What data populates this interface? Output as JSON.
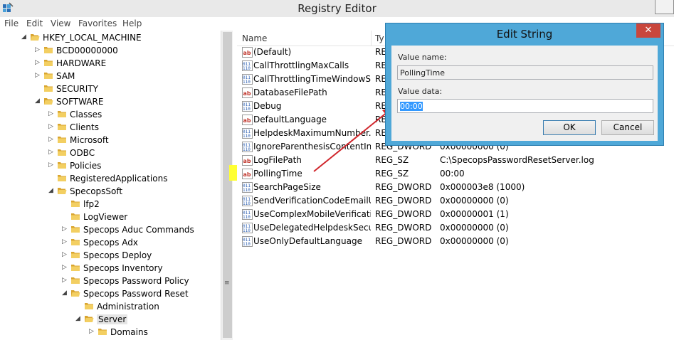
{
  "window": {
    "title": "Registry Editor"
  },
  "menu": [
    "File",
    "Edit",
    "View",
    "Favorites",
    "Help"
  ],
  "tree": [
    {
      "label": "HKEY_LOCAL_MACHINE",
      "state": "expanded"
    },
    {
      "label": "BCD00000000",
      "state": "collapsed"
    },
    {
      "label": "HARDWARE",
      "state": "collapsed"
    },
    {
      "label": "SAM",
      "state": "collapsed"
    },
    {
      "label": "SECURITY",
      "state": "none"
    },
    {
      "label": "SOFTWARE",
      "state": "expanded"
    },
    {
      "label": "Classes",
      "state": "collapsed"
    },
    {
      "label": "Clients",
      "state": "collapsed"
    },
    {
      "label": "Microsoft",
      "state": "collapsed"
    },
    {
      "label": "ODBC",
      "state": "collapsed"
    },
    {
      "label": "Policies",
      "state": "collapsed"
    },
    {
      "label": "RegisteredApplications",
      "state": "none"
    },
    {
      "label": "SpecopsSoft",
      "state": "expanded"
    },
    {
      "label": "lfp2",
      "state": "none"
    },
    {
      "label": "LogViewer",
      "state": "none"
    },
    {
      "label": "Specops Aduc Commands",
      "state": "collapsed"
    },
    {
      "label": "Specops Adx",
      "state": "collapsed"
    },
    {
      "label": "Specops Deploy",
      "state": "collapsed"
    },
    {
      "label": "Specops Inventory",
      "state": "collapsed"
    },
    {
      "label": "Specops Password Policy",
      "state": "collapsed"
    },
    {
      "label": "Specops Password Reset",
      "state": "expanded"
    },
    {
      "label": "Administration",
      "state": "none"
    },
    {
      "label": "Server",
      "state": "expanded"
    },
    {
      "label": "Domains",
      "state": "collapsed"
    }
  ],
  "list": {
    "columns": [
      "Name",
      "Ty"
    ],
    "rows": [
      {
        "name": "(Default)",
        "type": "REG",
        "data": "",
        "icon": "string-value-icon"
      },
      {
        "name": "CallThrottlingMaxCalls",
        "type": "REG",
        "data": "",
        "icon": "dword-value-icon"
      },
      {
        "name": "CallThrottlingTimeWindowS...",
        "type": "REG",
        "data": "",
        "icon": "dword-value-icon"
      },
      {
        "name": "DatabaseFilePath",
        "type": "REG",
        "data": "",
        "icon": "string-value-icon"
      },
      {
        "name": "Debug",
        "type": "REG",
        "data": "",
        "icon": "dword-value-icon"
      },
      {
        "name": "DefaultLanguage",
        "type": "REG",
        "data": "",
        "icon": "string-value-icon"
      },
      {
        "name": "HelpdeskMaximumNumber...",
        "type": "REG",
        "data": "",
        "icon": "dword-value-icon"
      },
      {
        "name": "IgnoreParenthesisContentInP...",
        "type": "REG_DWORD",
        "data": "0x00000000 (0)",
        "icon": "dword-value-icon"
      },
      {
        "name": "LogFilePath",
        "type": "REG_SZ",
        "data": "C:\\SpecopsPasswordResetServer.log",
        "icon": "string-value-icon"
      },
      {
        "name": "PollingTime",
        "type": "REG_SZ",
        "data": "00:00",
        "icon": "string-value-icon"
      },
      {
        "name": "SearchPageSize",
        "type": "REG_DWORD",
        "data": "0x000003e8 (1000)",
        "icon": "dword-value-icon"
      },
      {
        "name": "SendVerificationCodeEmailU...",
        "type": "REG_DWORD",
        "data": "0x00000000 (0)",
        "icon": "dword-value-icon"
      },
      {
        "name": "UseComplexMobileVerificati...",
        "type": "REG_DWORD",
        "data": "0x00000001 (1)",
        "icon": "dword-value-icon"
      },
      {
        "name": "UseDelegatedHelpdeskSecurity",
        "type": "REG_DWORD",
        "data": "0x00000000 (0)",
        "icon": "dword-value-icon"
      },
      {
        "name": "UseOnlyDefaultLanguage",
        "type": "REG_DWORD",
        "data": "0x00000000 (0)",
        "icon": "dword-value-icon"
      }
    ]
  },
  "dialog": {
    "title": "Edit String",
    "close": "✕",
    "value_name_label": "Value name:",
    "value_name": "PollingTime",
    "value_data_label": "Value data:",
    "value_data": "00:00",
    "ok": "OK",
    "cancel": "Cancel"
  },
  "colors": {
    "highlight": "#ffff33",
    "arrow": "#d0262c",
    "dialog_frame": "#4fa8d8"
  }
}
